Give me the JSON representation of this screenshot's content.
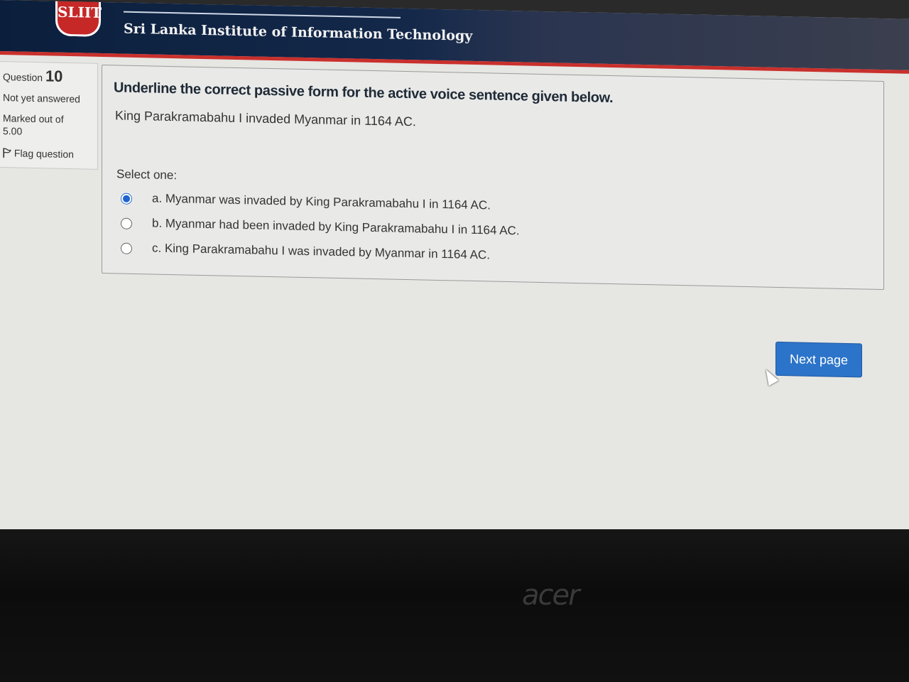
{
  "header": {
    "logo_text": "SLIIT",
    "institute_name": "Sri Lanka Institute of Information Technology"
  },
  "question_info": {
    "label": "Question",
    "number": "10",
    "state": "Not yet answered",
    "marks_label": "Marked out of",
    "marks_value": "5.00",
    "flag_label": "Flag question",
    "flag_icon": "flag-icon"
  },
  "question": {
    "prompt": "Underline the correct passive form for the active voice sentence given below.",
    "sentence": "King Parakramabahu I invaded Myanmar in 1164 AC.",
    "select_label": "Select one:",
    "options": [
      {
        "label": "a. Myanmar was invaded by King Parakramabahu I  in 1164 AC.",
        "selected": true
      },
      {
        "label": "b. Myanmar had been invaded by King Parakramabahu I  in 1164 AC.",
        "selected": false
      },
      {
        "label": "c. King Parakramabahu I was invaded by Myanmar  in 1164 AC.",
        "selected": false
      }
    ]
  },
  "navigation": {
    "next_label": "Next page"
  },
  "device": {
    "brand": "acer"
  },
  "colors": {
    "header_bg": "#0b1f3d",
    "header_border": "#c9302c",
    "button_bg": "#2c74c9",
    "radio_selected": "#1e63cf"
  }
}
